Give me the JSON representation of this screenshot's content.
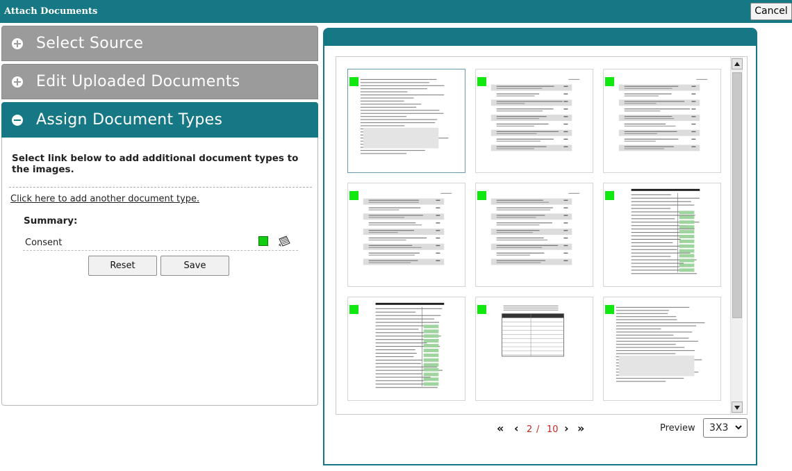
{
  "window": {
    "title": "Attach Documents",
    "cancel_label": "Cancel"
  },
  "accordion": {
    "sections": [
      {
        "label": "Select Source",
        "state": "collapsed"
      },
      {
        "label": "Edit Uploaded Documents",
        "state": "collapsed"
      },
      {
        "label": "Assign Document Types",
        "state": "expanded"
      }
    ]
  },
  "assign": {
    "instructions": "Select link below to add additional document types to the images.",
    "add_link": "Click here to add another document type.",
    "summary_label": "Summary:",
    "summary_items": [
      {
        "type": "Consent",
        "color": "#12cc12"
      }
    ],
    "reset_label": "Reset",
    "save_label": "Save"
  },
  "preview": {
    "thumbnails": [
      {
        "kind": "text",
        "marked": true,
        "selected": true
      },
      {
        "kind": "table",
        "marked": true,
        "selected": false
      },
      {
        "kind": "table",
        "marked": true,
        "selected": false
      },
      {
        "kind": "table",
        "marked": true,
        "selected": false
      },
      {
        "kind": "table",
        "marked": true,
        "selected": false
      },
      {
        "kind": "form",
        "marked": true,
        "selected": false
      },
      {
        "kind": "form",
        "marked": true,
        "selected": false
      },
      {
        "kind": "grid",
        "marked": true,
        "selected": false
      },
      {
        "kind": "text",
        "marked": true,
        "selected": false
      }
    ],
    "pager": {
      "current": "2",
      "separator": "/",
      "total": "10"
    },
    "preview_label": "Preview",
    "grid_option": "3X3",
    "accent_color": "#167785",
    "page_color": "#cc2222"
  }
}
